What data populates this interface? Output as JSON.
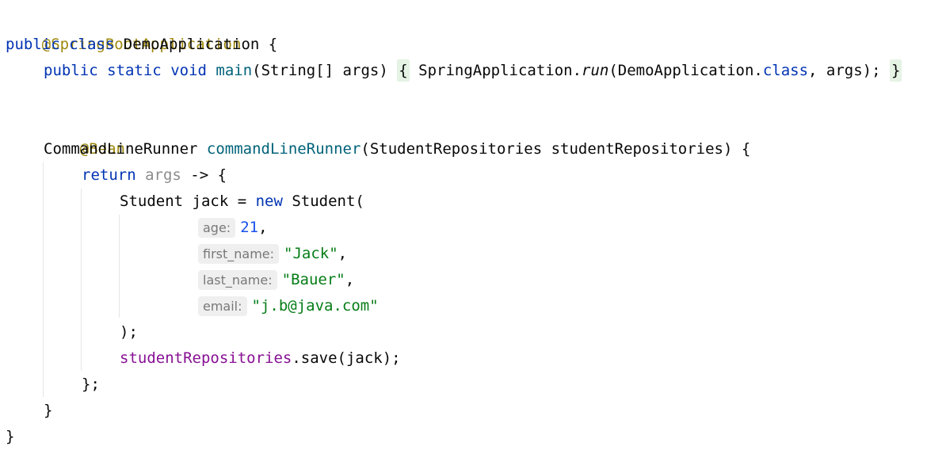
{
  "code": {
    "l1_annotation": "@SpringBootApplication",
    "l2_public": "public",
    "l2_class": "class",
    "l2_name": "DemoApplication",
    "l2_brace": "{",
    "l3_public": "public",
    "l3_static": "static",
    "l3_void": "void",
    "l3_main": "main",
    "l3_args": "(String[] args)",
    "l3_open": "{",
    "l3_call": "SpringApplication.",
    "l3_run": "run",
    "l3_paren": "(DemoApplication.",
    "l3_classkw": "class",
    "l3_rest": ", args);",
    "l3_close": "}",
    "l5_annotation": "@Bean",
    "l6_type": "CommandLineRunner",
    "l6_method": "commandLineRunner",
    "l6_params": "(StudentRepositories studentRepositories) {",
    "l7_return": "return",
    "l7_args": "args",
    "l7_arrow": " -> {",
    "l8_decl": "Student jack = ",
    "l8_new": "new",
    "l8_ctor": " Student(",
    "hint_age": "age:",
    "val_age": "21",
    "hint_first": "first_name:",
    "val_first": "\"Jack\"",
    "hint_last": "last_name:",
    "val_last": "\"Bauer\"",
    "hint_email": "email:",
    "val_email": "\"j.b@java.com\"",
    "comma": ",",
    "close_paren": ");",
    "l14_field": "studentRepositories",
    "l14_call": ".save(jack);",
    "l15_close": "};",
    "l16_close": "}",
    "l17_close": "}"
  }
}
